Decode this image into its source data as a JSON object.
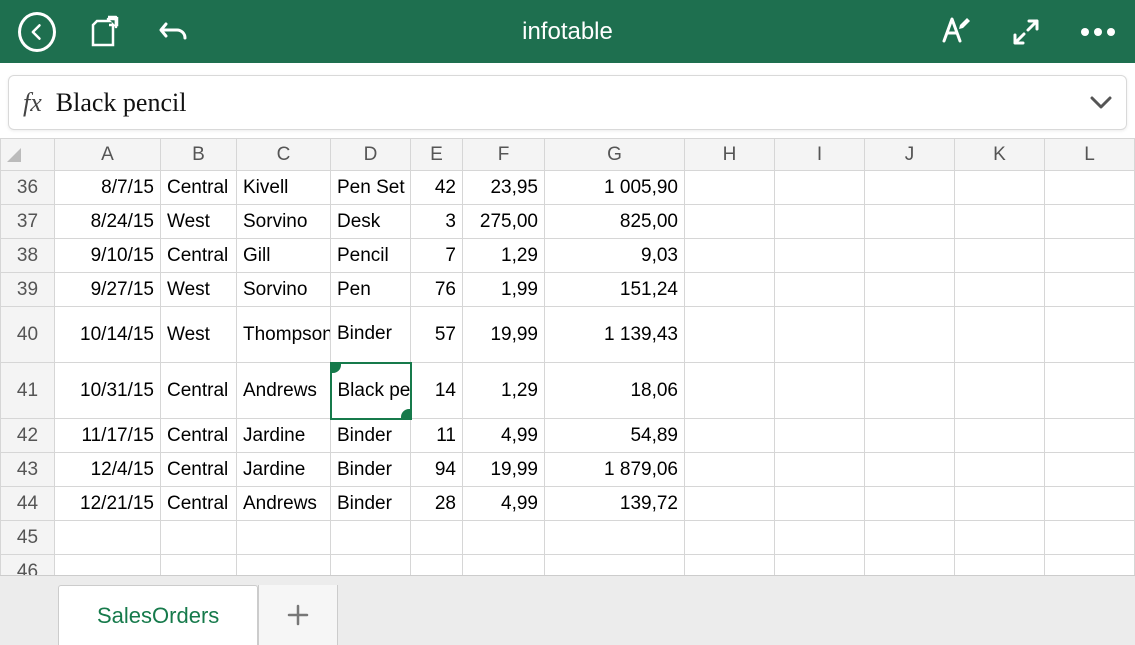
{
  "header": {
    "title": "infotable"
  },
  "formula_bar": {
    "fx_label": "fx",
    "value": "Black pencil"
  },
  "columns": [
    "A",
    "B",
    "C",
    "D",
    "E",
    "F",
    "G",
    "H",
    "I",
    "J",
    "K",
    "L"
  ],
  "selected_column": "D",
  "selected_row_label": "41",
  "rows": [
    {
      "n": "36",
      "a": "8/7/15",
      "b": "Central",
      "c": "Kivell",
      "d": "Pen Set",
      "e": "42",
      "f": "23,95",
      "g": "1 005,90"
    },
    {
      "n": "37",
      "a": "8/24/15",
      "b": "West",
      "c": "Sorvino",
      "d": "Desk",
      "e": "3",
      "f": "275,00",
      "g": "825,00"
    },
    {
      "n": "38",
      "a": "9/10/15",
      "b": "Central",
      "c": "Gill",
      "d": "Pencil",
      "e": "7",
      "f": "1,29",
      "g": "9,03"
    },
    {
      "n": "39",
      "a": "9/27/15",
      "b": "West",
      "c": "Sorvino",
      "d": "Pen",
      "e": "76",
      "f": "1,99",
      "g": "151,24"
    },
    {
      "n": "40",
      "a": "10/14/15",
      "b": "West",
      "c": "Thompson",
      "d": "Binder",
      "e": "57",
      "f": "19,99",
      "g": "1 139,43",
      "tall": true,
      "wrap_c": true
    },
    {
      "n": "41",
      "a": "10/31/15",
      "b": "Central",
      "c": "Andrews",
      "d": "Black pencil",
      "e": "14",
      "f": "1,29",
      "g": "18,06",
      "selected": true,
      "tall": true
    },
    {
      "n": "42",
      "a": "11/17/15",
      "b": "Central",
      "c": "Jardine",
      "d": "Binder",
      "e": "11",
      "f": "4,99",
      "g": "54,89"
    },
    {
      "n": "43",
      "a": "12/4/15",
      "b": "Central",
      "c": "Jardine",
      "d": "Binder",
      "e": "94",
      "f": "19,99",
      "g": "1 879,06"
    },
    {
      "n": "44",
      "a": "12/21/15",
      "b": "Central",
      "c": "Andrews",
      "d": "Binder",
      "e": "28",
      "f": "4,99",
      "g": "139,72"
    },
    {
      "n": "45",
      "a": "",
      "b": "",
      "c": "",
      "d": "",
      "e": "",
      "f": "",
      "g": ""
    },
    {
      "n": "46",
      "a": "",
      "b": "",
      "c": "",
      "d": "",
      "e": "",
      "f": "",
      "g": ""
    }
  ],
  "sheet_tab": {
    "active": "SalesOrders"
  }
}
